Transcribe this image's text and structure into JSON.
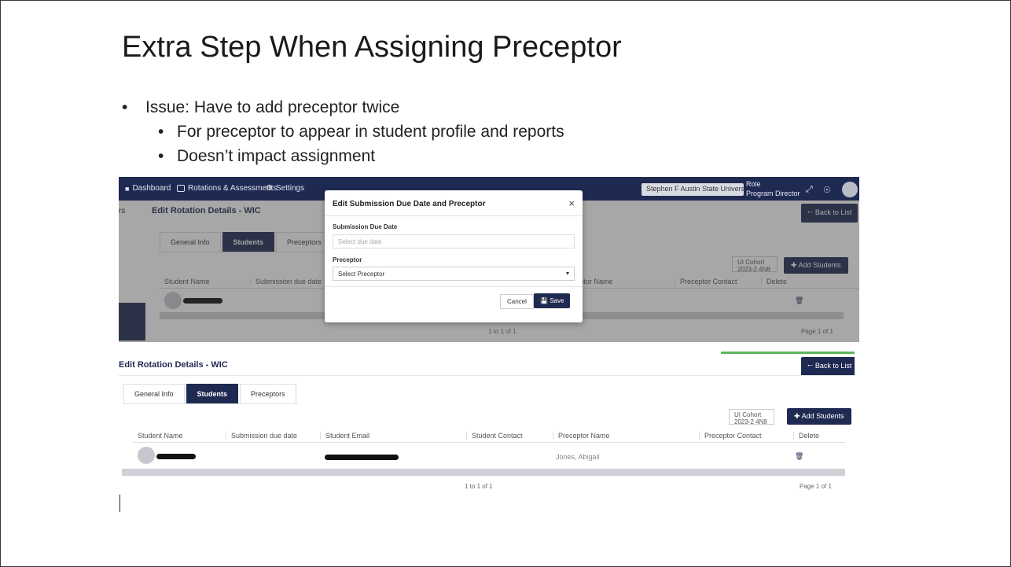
{
  "slide": {
    "title": "Extra Step When Assigning Preceptor",
    "bullets": [
      {
        "text": "Issue: Have to add preceptor twice",
        "level": 0
      },
      {
        "text": "For preceptor to appear in student profile and reports",
        "level": 1
      },
      {
        "text": "Doesn’t impact assignment",
        "level": 1
      }
    ]
  },
  "shot1": {
    "appbar": {
      "nav": [
        "Dashboard",
        "Rotations & Assessments",
        "Settings"
      ],
      "org_select": "Stephen F Austin State Universi...",
      "role_label": "Role",
      "role_value": "Program Director"
    },
    "left_rail_label": "rs",
    "page_title": "Edit Rotation Details - WIC",
    "back_label": "Back to List",
    "tabs": [
      "General Info",
      "Students",
      "Preceptors"
    ],
    "active_tab": "Students",
    "cohort_text": "UI Cohort 2023-2 4N8",
    "add_students": "Add Students",
    "columns_left": [
      "Student Name",
      "Submission due date"
    ],
    "columns_right": [
      "ceptor Name",
      "Preceptor Contact",
      "Delete"
    ],
    "pager_count": "1 to 1 of 1",
    "pager_page": "Page 1 of 1",
    "modal": {
      "title": "Edit Submission Due Date and Preceptor",
      "close": "×",
      "due_label": "Submission Due Date",
      "due_placeholder": "Select due date",
      "preceptor_label": "Preceptor",
      "preceptor_value": "Select Preceptor",
      "cancel": "Cancel",
      "save": "Save"
    }
  },
  "shot2": {
    "page_title": "Edit Rotation Details - WIC",
    "back_label": "Back to List",
    "tabs": [
      "General Info",
      "Students",
      "Preceptors"
    ],
    "active_tab": "Students",
    "cohort_text": "UI Cohort 2023-2 4N8",
    "add_students": "Add Students",
    "columns": [
      "Student Name",
      "Submission due date",
      "Student Email",
      "Student Contact",
      "Preceptor Name",
      "Preceptor Contact",
      "Delete"
    ],
    "row": {
      "preceptor_name": "Jones, Abigail"
    },
    "pager_count": "1 to 1 of 1",
    "pager_page": "Page 1 of 1"
  }
}
